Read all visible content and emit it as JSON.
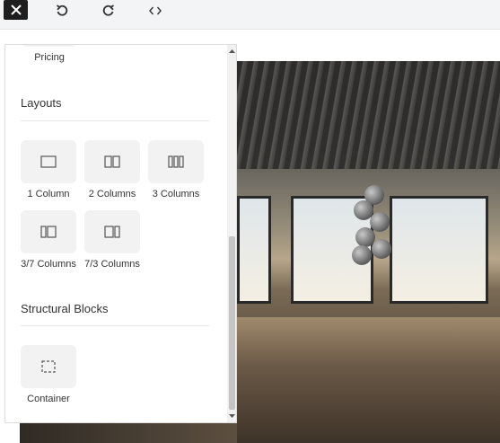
{
  "toolbar": {
    "close_icon": "close-icon",
    "undo_icon": "undo-icon",
    "redo_icon": "redo-icon",
    "code_icon": "code-icon"
  },
  "panel": {
    "pricing_label": "Pricing",
    "layouts": {
      "title": "Layouts",
      "items": [
        {
          "label": "1 Column",
          "icon": "one-column-icon"
        },
        {
          "label": "2 Columns",
          "icon": "two-columns-icon"
        },
        {
          "label": "3 Columns",
          "icon": "three-columns-icon"
        },
        {
          "label": "3/7 Columns",
          "icon": "three-seven-columns-icon"
        },
        {
          "label": "7/3 Columns",
          "icon": "seven-three-columns-icon"
        }
      ]
    },
    "structural": {
      "title": "Structural Blocks",
      "items": [
        {
          "label": "Container",
          "icon": "container-icon"
        }
      ]
    }
  },
  "scroll": {
    "position_fraction": 0.5
  }
}
